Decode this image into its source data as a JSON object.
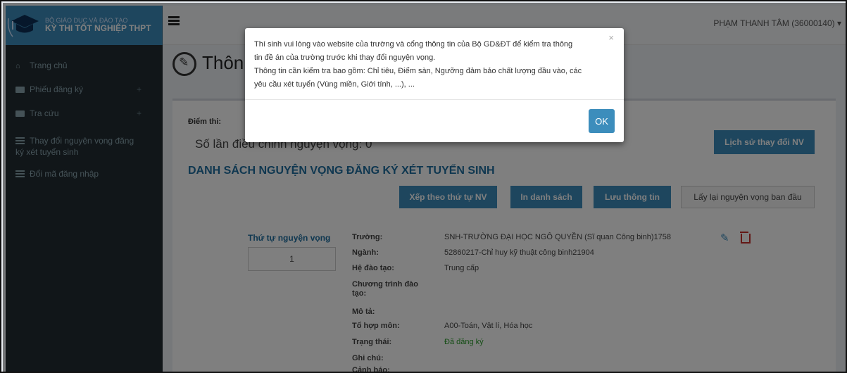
{
  "brand": {
    "line1": "BỘ GIÁO DỤC VÀ ĐÀO TẠO",
    "line2": "KỲ THI TỐT NGHIỆP THPT",
    "icon": "graduation-cap-icon"
  },
  "topbar": {
    "user": "PHẠM THANH TÂM (36000140) ▾"
  },
  "sidebar": {
    "items": [
      {
        "label": "Trang chủ",
        "icon": "home-icon"
      },
      {
        "label": "Phiếu đăng ký",
        "icon": "folder-icon",
        "expand": "+"
      },
      {
        "label": "Tra cứu",
        "icon": "folder-icon",
        "expand": "+"
      },
      {
        "label": "Thay đổi nguyện vọng đăng ký xét tuyển sinh",
        "icon": "list-icon"
      },
      {
        "label": "Đổi mã đăng nhập",
        "icon": "list-icon"
      }
    ]
  },
  "page": {
    "title": "Thôn"
  },
  "content": {
    "diem_thi_label": "Điểm thi:",
    "so_lan": "Số lần điều chỉnh nguyện vọng: 0",
    "history_button": "Lịch sử thay đổi NV",
    "section_title": "DANH SÁCH NGUYỆN VỌNG ĐĂNG KÝ XÉT TUYỂN SINH",
    "buttons": {
      "sort": "Xếp theo thứ tự NV",
      "print": "In danh sách",
      "save": "Lưu thông tin",
      "restore": "Lấy lại nguyện vọng ban đầu"
    },
    "wish": {
      "order_label": "Thứ tự nguyện vọng",
      "order_value": "1",
      "truong_label": "Trường:",
      "truong_value": "SNH-TRƯỜNG ĐẠI HỌC NGÔ QUYỀN (Sĩ quan Công binh)1758",
      "nganh_label": "Ngành:",
      "nganh_value": "52860217-Chỉ huy kỹ thuật công binh21904",
      "hedaotao_label": "Hệ đào tạo:",
      "hedaotao_value": "Trung cấp",
      "chuongtrinh_label": "Chương trình đào tạo:",
      "mota_label": "Mô tả:",
      "tohop_label": "Tổ hợp môn:",
      "tohop_value": "A00-Toán, Vật lí, Hóa học",
      "trangthai_label": "Trạng thái:",
      "trangthai_value": "Đã đăng ký",
      "ghichu_label": "Ghi chú:",
      "canhbao_label": "Cảnh báo:"
    }
  },
  "modal": {
    "line1": "Thí sinh vui lòng vào website của trường và cổng thông tin của Bộ GD&ĐT để kiểm tra thông",
    "line2": "tin đề án của trường trước khi thay đổi nguyện vọng.",
    "line3": "Thông tin cần kiểm tra bao gồm: Chỉ tiêu, Điểm sàn, Ngưỡng đảm bảo chất lượng đầu vào, các",
    "line4": "yêu cầu xét tuyển (Vùng miền, Giới tính, ...), ...",
    "close": "×",
    "ok": "OK"
  },
  "colors": {
    "primary": "#3c8dbc",
    "sidebar_bg": "#222d32",
    "section_title": "#1e6fa0",
    "status_green": "#2a9b2a",
    "danger": "#c9302c"
  }
}
